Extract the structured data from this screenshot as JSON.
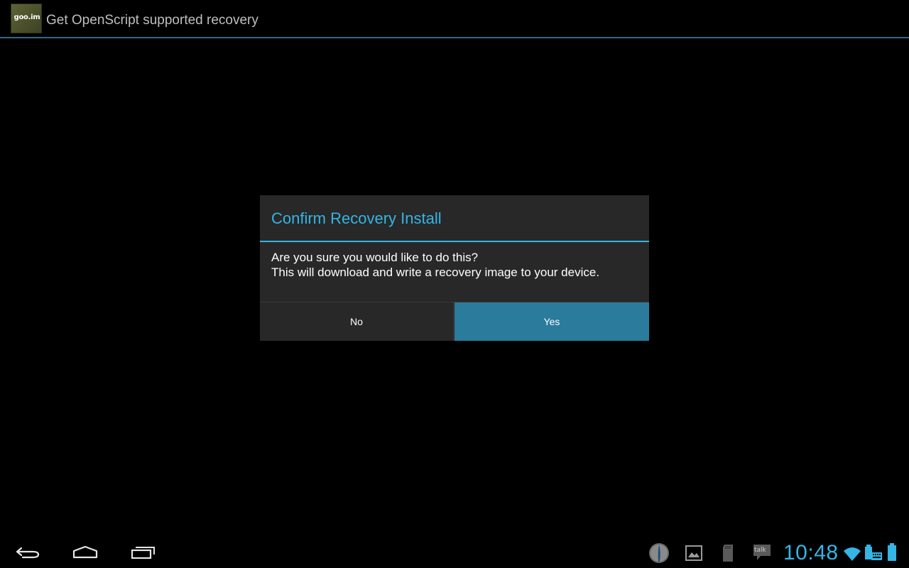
{
  "action_bar": {
    "app_icon_text": "goo.im",
    "title": "Get OpenScript supported recovery"
  },
  "dialog": {
    "title": "Confirm Recovery Install",
    "message_lines": [
      "Are you sure you would like to do this?",
      "This will download and write a recovery image to your device."
    ],
    "buttons": {
      "no_label": "No",
      "yes_label": "Yes"
    }
  },
  "system_bar": {
    "nav": [
      {
        "name": "back-icon"
      },
      {
        "name": "home-icon"
      },
      {
        "name": "recent-apps-icon"
      }
    ],
    "notifications": [
      {
        "name": "app-notification-icon"
      },
      {
        "name": "gallery-icon"
      },
      {
        "name": "sd-card-icon"
      },
      {
        "name": "talk-icon",
        "label": "talk"
      }
    ],
    "clock": "10:48",
    "status": [
      {
        "name": "wifi-icon"
      },
      {
        "name": "keyboard-icon"
      },
      {
        "name": "battery-icon"
      }
    ]
  },
  "colors": {
    "accent": "#33b5e5",
    "positive_button": "#2b7b9d",
    "dialog_bg": "#282828",
    "background": "#000000",
    "title_text": "#bfbfbf"
  }
}
